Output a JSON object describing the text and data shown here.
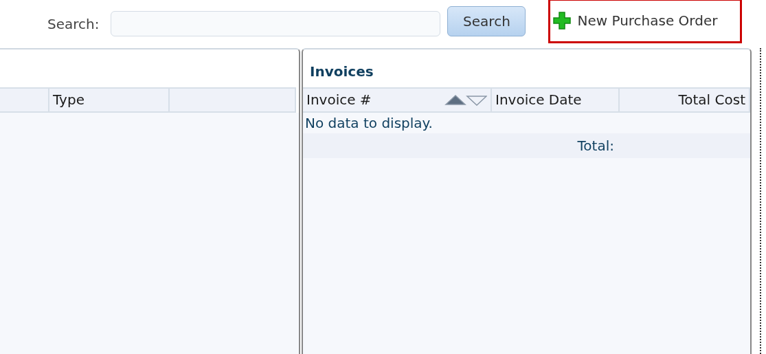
{
  "toolbar": {
    "search_label": "Search:",
    "search_button": "Search",
    "new_button": "New Purchase Order",
    "new_highlighted": true
  },
  "left_grid": {
    "columns": [
      {},
      {
        "label": "Type"
      },
      {}
    ]
  },
  "invoices": {
    "title": "Invoices",
    "columns": [
      {
        "label": "Invoice #",
        "sorted": true,
        "ascending": true
      },
      {
        "label": "Invoice Date",
        "sorted": false
      },
      {
        "label": "Total Cost",
        "sorted": false
      }
    ],
    "empty_message": "No data to display.",
    "total_label": "Total:"
  }
}
